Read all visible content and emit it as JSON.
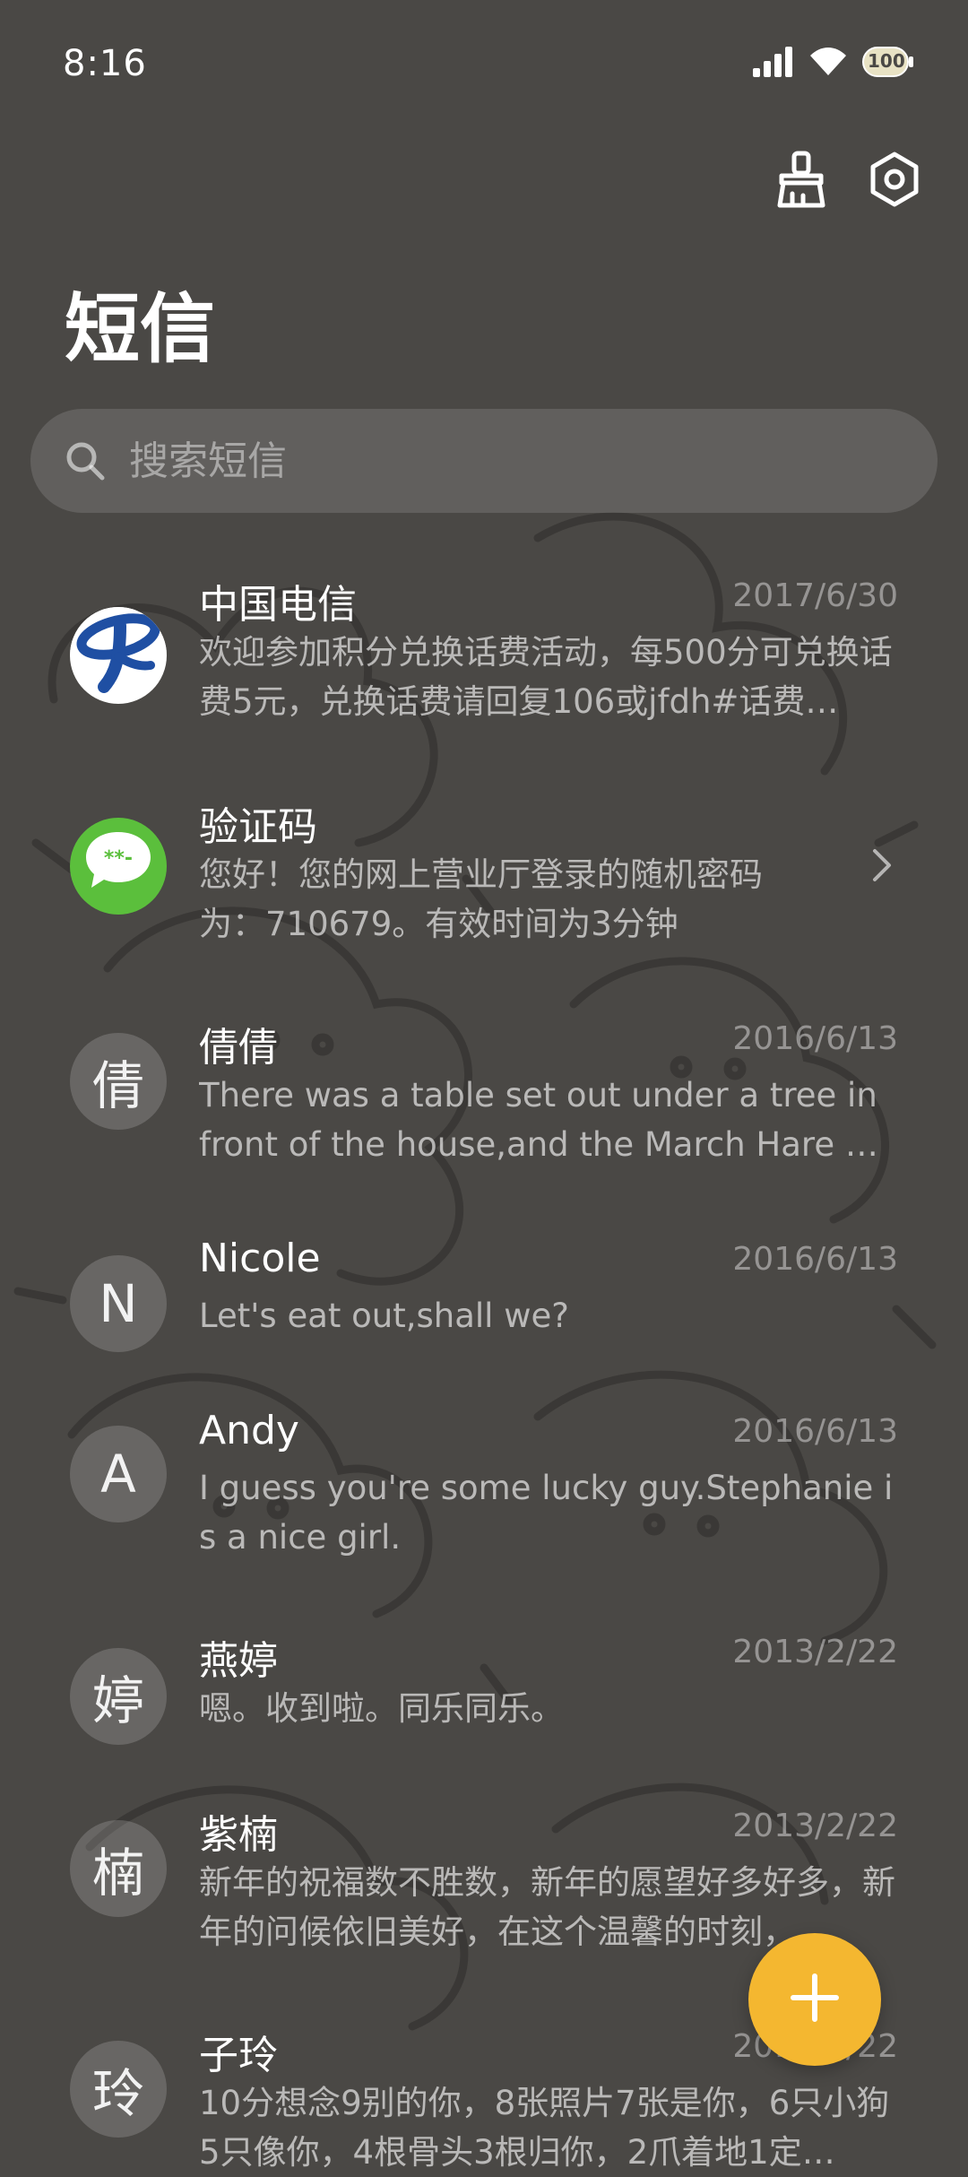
{
  "status_bar": {
    "time": "8:16",
    "battery_level": "100",
    "icons": [
      "signal-icon",
      "wifi-icon",
      "battery-icon"
    ]
  },
  "header": {
    "title": "短信",
    "actions": [
      "broom-icon",
      "settings-icon"
    ]
  },
  "search": {
    "placeholder": "搜索短信"
  },
  "conversations": [
    {
      "avatar": "china-telecom-logo",
      "name": "中国电信",
      "date": "2017/6/30",
      "preview": "欢迎参加积分兑换话费活动，每500分可兑换话费5元，兑换话费请回复106或jfdh#话费…"
    },
    {
      "avatar": "verification-code-icon",
      "avatar_text": "**-",
      "name": "验证码",
      "date": "",
      "preview": "您好！您的网上营业厅登录的随机密码为：710679。有效时间为3分钟"
    },
    {
      "avatar_text": "倩",
      "name": "倩倩",
      "date": "2016/6/13",
      "preview": "There was a table set out under a tree in front of the house,and the March Hare an…"
    },
    {
      "avatar_text": "N",
      "name": "Nicole",
      "date": "2016/6/13",
      "preview": "Let's eat out,shall we?"
    },
    {
      "avatar_text": "A",
      "name": "Andy",
      "date": "2016/6/13",
      "preview": "I guess you're some lucky guy.Stephanie is a nice girl."
    },
    {
      "avatar_text": "婷",
      "name": "燕婷",
      "date": "2013/2/22",
      "preview": "嗯。收到啦。同乐同乐。"
    },
    {
      "avatar_text": "楠",
      "name": "紫楠",
      "date": "2013/2/22",
      "preview": "新年的祝福数不胜数，新年的愿望好多好多，新年的问候依旧美好，在这个温馨的时刻，…"
    },
    {
      "avatar_text": "玲",
      "name": "子玲",
      "date": "2013/2/22",
      "preview": "10分想念9别的你，8张照片7张是你，6只小狗5只像你，4根骨头3根归你，2爪着地1定…"
    }
  ],
  "fab": {
    "icon": "plus-icon"
  },
  "colors": {
    "background": "#4a4845",
    "fab": "#f4b730",
    "telecom_blue": "#1f4fa3",
    "code_green": "#5bbf3c"
  }
}
